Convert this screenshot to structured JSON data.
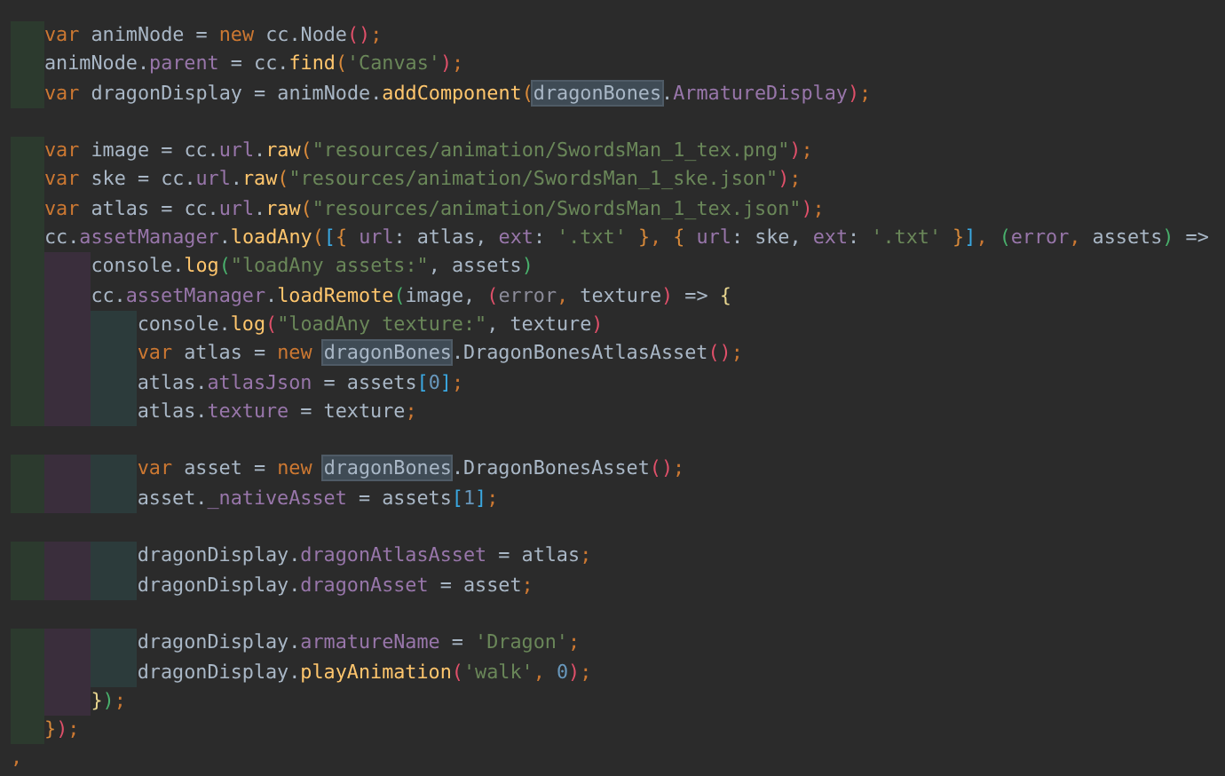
{
  "editor": {
    "lines": [
      {
        "kind": "code",
        "tokens": [
          {
            "kind": "keyword",
            "text": "var "
          },
          {
            "kind": "ident",
            "text": "animNode = "
          },
          {
            "kind": "keyword",
            "text": "new "
          },
          {
            "kind": "ident",
            "text": "cc.Node"
          },
          {
            "kind": "bracket_pink",
            "text": "()"
          },
          {
            "kind": "punct",
            "text": ";"
          }
        ]
      },
      {
        "kind": "code",
        "tokens": [
          {
            "kind": "ident",
            "text": "animNode."
          },
          {
            "kind": "property",
            "text": "parent"
          },
          {
            "kind": "ident",
            "text": " = cc."
          },
          {
            "kind": "function",
            "text": "find"
          },
          {
            "kind": "bracket_orange",
            "text": "("
          },
          {
            "kind": "string",
            "text": "'Canvas'"
          },
          {
            "kind": "bracket_pink",
            "text": ")"
          },
          {
            "kind": "punct",
            "text": ";"
          }
        ]
      },
      {
        "kind": "code",
        "tokens": [
          {
            "kind": "keyword",
            "text": "var "
          },
          {
            "kind": "ident",
            "text": "dragonDisplay = animNode."
          },
          {
            "kind": "function",
            "text": "addComponent"
          },
          {
            "kind": "bracket_orange",
            "text": "("
          },
          {
            "kind": "highlight",
            "text": "dragonBones"
          },
          {
            "kind": "ident",
            "text": "."
          },
          {
            "kind": "property",
            "text": "ArmatureDisplay"
          },
          {
            "kind": "bracket_pink",
            "text": ")"
          },
          {
            "kind": "punct",
            "text": ";"
          }
        ]
      },
      {
        "kind": "blank"
      },
      {
        "kind": "code",
        "tokens": [
          {
            "kind": "keyword",
            "text": "var "
          },
          {
            "kind": "ident",
            "text": "image = cc."
          },
          {
            "kind": "property",
            "text": "url"
          },
          {
            "kind": "ident",
            "text": "."
          },
          {
            "kind": "function",
            "text": "raw"
          },
          {
            "kind": "bracket_orange",
            "text": "("
          },
          {
            "kind": "string",
            "text": "\"resources/animation/SwordsMan_1_tex.png\""
          },
          {
            "kind": "bracket_pink",
            "text": ")"
          },
          {
            "kind": "punct",
            "text": ";"
          }
        ]
      },
      {
        "kind": "code",
        "tokens": [
          {
            "kind": "keyword",
            "text": "var "
          },
          {
            "kind": "ident",
            "text": "ske = cc."
          },
          {
            "kind": "property",
            "text": "url"
          },
          {
            "kind": "ident",
            "text": "."
          },
          {
            "kind": "function",
            "text": "raw"
          },
          {
            "kind": "bracket_orange",
            "text": "("
          },
          {
            "kind": "string",
            "text": "\"resources/animation/SwordsMan_1_ske.json\""
          },
          {
            "kind": "bracket_pink",
            "text": ")"
          },
          {
            "kind": "punct",
            "text": ";"
          }
        ]
      },
      {
        "kind": "code",
        "tokens": [
          {
            "kind": "keyword",
            "text": "var "
          },
          {
            "kind": "ident",
            "text": "atlas = cc."
          },
          {
            "kind": "property",
            "text": "url"
          },
          {
            "kind": "ident",
            "text": "."
          },
          {
            "kind": "function",
            "text": "raw"
          },
          {
            "kind": "bracket_orange",
            "text": "("
          },
          {
            "kind": "string",
            "text": "\"resources/animation/SwordsMan_1_tex.json\""
          },
          {
            "kind": "bracket_pink",
            "text": ")"
          },
          {
            "kind": "punct",
            "text": ";"
          }
        ]
      },
      {
        "kind": "code",
        "tokens": [
          {
            "kind": "ident",
            "text": "cc."
          },
          {
            "kind": "property",
            "text": "assetManager"
          },
          {
            "kind": "ident",
            "text": "."
          },
          {
            "kind": "function",
            "text": "loadAny"
          },
          {
            "kind": "bracket_orange",
            "text": "("
          },
          {
            "kind": "bracket_blue",
            "text": "["
          },
          {
            "kind": "bracket_orange",
            "text": "{ "
          },
          {
            "kind": "property",
            "text": "url"
          },
          {
            "kind": "ident",
            "text": ": atlas, "
          },
          {
            "kind": "property",
            "text": "ext"
          },
          {
            "kind": "ident",
            "text": ": "
          },
          {
            "kind": "string",
            "text": "'.txt'"
          },
          {
            "kind": "bracket_orange",
            "text": " }"
          },
          {
            "kind": "punct",
            "text": ", "
          },
          {
            "kind": "bracket_orange",
            "text": "{ "
          },
          {
            "kind": "property",
            "text": "url"
          },
          {
            "kind": "ident",
            "text": ": ske, "
          },
          {
            "kind": "property",
            "text": "ext"
          },
          {
            "kind": "ident",
            "text": ": "
          },
          {
            "kind": "string",
            "text": "'.txt'"
          },
          {
            "kind": "bracket_orange",
            "text": " }"
          },
          {
            "kind": "bracket_blue",
            "text": "]"
          },
          {
            "kind": "punct",
            "text": ", "
          },
          {
            "kind": "bracket_green",
            "text": "("
          },
          {
            "kind": "property",
            "text": "error"
          },
          {
            "kind": "punct",
            "text": ", "
          },
          {
            "kind": "ident",
            "text": "assets"
          },
          {
            "kind": "bracket_green",
            "text": ")"
          },
          {
            "kind": "ident",
            "text": " =>"
          }
        ],
        "children": [
          {
            "kind": "code",
            "tokens": [
              {
                "kind": "ident",
                "text": "console."
              },
              {
                "kind": "function",
                "text": "log"
              },
              {
                "kind": "bracket_green",
                "text": "("
              },
              {
                "kind": "string",
                "text": "\"loadAny assets:\""
              },
              {
                "kind": "ident",
                "text": ", assets"
              },
              {
                "kind": "bracket_green",
                "text": ")"
              }
            ]
          },
          {
            "kind": "code",
            "tokens": [
              {
                "kind": "ident",
                "text": "cc."
              },
              {
                "kind": "property",
                "text": "assetManager"
              },
              {
                "kind": "ident",
                "text": "."
              },
              {
                "kind": "function",
                "text": "loadRemote"
              },
              {
                "kind": "bracket_green",
                "text": "("
              },
              {
                "kind": "ident",
                "text": "image, "
              },
              {
                "kind": "bracket_pink",
                "text": "("
              },
              {
                "kind": "param",
                "text": "error"
              },
              {
                "kind": "punct",
                "text": ", "
              },
              {
                "kind": "ident",
                "text": "texture"
              },
              {
                "kind": "bracket_pink",
                "text": ")"
              },
              {
                "kind": "ident",
                "text": " => "
              },
              {
                "kind": "bracket_yellow",
                "text": "{"
              }
            ],
            "children": [
              {
                "kind": "code",
                "tokens": [
                  {
                    "kind": "ident",
                    "text": "console."
                  },
                  {
                    "kind": "function",
                    "text": "log"
                  },
                  {
                    "kind": "bracket_pink",
                    "text": "("
                  },
                  {
                    "kind": "string",
                    "text": "\"loadAny texture:\""
                  },
                  {
                    "kind": "ident",
                    "text": ", texture"
                  },
                  {
                    "kind": "bracket_pink",
                    "text": ")"
                  }
                ]
              },
              {
                "kind": "code",
                "tokens": [
                  {
                    "kind": "keyword",
                    "text": "var "
                  },
                  {
                    "kind": "ident",
                    "text": "atlas = "
                  },
                  {
                    "kind": "keyword",
                    "text": "new "
                  },
                  {
                    "kind": "highlight",
                    "text": "dragonBones"
                  },
                  {
                    "kind": "ident",
                    "text": ".DragonBonesAtlasAsset"
                  },
                  {
                    "kind": "bracket_pink",
                    "text": "()"
                  },
                  {
                    "kind": "punct",
                    "text": ";"
                  }
                ]
              },
              {
                "kind": "code",
                "tokens": [
                  {
                    "kind": "ident",
                    "text": "atlas."
                  },
                  {
                    "kind": "property",
                    "text": "atlasJson"
                  },
                  {
                    "kind": "ident",
                    "text": " = assets"
                  },
                  {
                    "kind": "bracket_blue",
                    "text": "["
                  },
                  {
                    "kind": "number",
                    "text": "0"
                  },
                  {
                    "kind": "bracket_blue",
                    "text": "]"
                  },
                  {
                    "kind": "punct",
                    "text": ";"
                  }
                ]
              },
              {
                "kind": "code",
                "tokens": [
                  {
                    "kind": "ident",
                    "text": "atlas."
                  },
                  {
                    "kind": "property",
                    "text": "texture"
                  },
                  {
                    "kind": "ident",
                    "text": " = texture"
                  },
                  {
                    "kind": "punct",
                    "text": ";"
                  }
                ]
              },
              {
                "kind": "blank"
              },
              {
                "kind": "code",
                "tokens": [
                  {
                    "kind": "keyword",
                    "text": "var "
                  },
                  {
                    "kind": "ident",
                    "text": "asset = "
                  },
                  {
                    "kind": "keyword",
                    "text": "new "
                  },
                  {
                    "kind": "highlight",
                    "text": "dragonBones"
                  },
                  {
                    "kind": "ident",
                    "text": ".DragonBonesAsset"
                  },
                  {
                    "kind": "bracket_pink",
                    "text": "()"
                  },
                  {
                    "kind": "punct",
                    "text": ";"
                  }
                ]
              },
              {
                "kind": "code",
                "tokens": [
                  {
                    "kind": "ident",
                    "text": "asset."
                  },
                  {
                    "kind": "property",
                    "text": "_nativeAsset"
                  },
                  {
                    "kind": "ident",
                    "text": " = assets"
                  },
                  {
                    "kind": "bracket_blue",
                    "text": "["
                  },
                  {
                    "kind": "number",
                    "text": "1"
                  },
                  {
                    "kind": "bracket_blue",
                    "text": "]"
                  },
                  {
                    "kind": "punct",
                    "text": ";"
                  }
                ]
              },
              {
                "kind": "blank"
              },
              {
                "kind": "code",
                "tokens": [
                  {
                    "kind": "ident",
                    "text": "dragonDisplay."
                  },
                  {
                    "kind": "property",
                    "text": "dragonAtlasAsset"
                  },
                  {
                    "kind": "ident",
                    "text": " = atlas"
                  },
                  {
                    "kind": "punct",
                    "text": ";"
                  }
                ]
              },
              {
                "kind": "code",
                "tokens": [
                  {
                    "kind": "ident",
                    "text": "dragonDisplay."
                  },
                  {
                    "kind": "property",
                    "text": "dragonAsset"
                  },
                  {
                    "kind": "ident",
                    "text": " = asset"
                  },
                  {
                    "kind": "punct",
                    "text": ";"
                  }
                ]
              },
              {
                "kind": "blank"
              },
              {
                "kind": "code",
                "tokens": [
                  {
                    "kind": "ident",
                    "text": "dragonDisplay."
                  },
                  {
                    "kind": "property",
                    "text": "armatureName"
                  },
                  {
                    "kind": "ident",
                    "text": " = "
                  },
                  {
                    "kind": "string",
                    "text": "'Dragon'"
                  },
                  {
                    "kind": "punct",
                    "text": ";"
                  }
                ]
              },
              {
                "kind": "code",
                "tokens": [
                  {
                    "kind": "ident",
                    "text": "dragonDisplay."
                  },
                  {
                    "kind": "function",
                    "text": "playAnimation"
                  },
                  {
                    "kind": "bracket_pink",
                    "text": "("
                  },
                  {
                    "kind": "string",
                    "text": "'walk'"
                  },
                  {
                    "kind": "punct",
                    "text": ", "
                  },
                  {
                    "kind": "number",
                    "text": "0"
                  },
                  {
                    "kind": "bracket_pink",
                    "text": ")"
                  },
                  {
                    "kind": "punct",
                    "text": ";"
                  }
                ]
              }
            ]
          },
          {
            "kind": "code",
            "tokens": [
              {
                "kind": "bracket_yellow",
                "text": "}"
              },
              {
                "kind": "bracket_green",
                "text": ")"
              },
              {
                "kind": "punct",
                "text": ";"
              }
            ]
          }
        ]
      },
      {
        "kind": "code",
        "tokens": [
          {
            "kind": "bracket_orange",
            "text": "}"
          },
          {
            "kind": "bracket_pink",
            "text": ")"
          },
          {
            "kind": "punct",
            "text": ";"
          }
        ]
      },
      {
        "kind": "stray",
        "tokens": [
          {
            "kind": "punct",
            "text": ","
          }
        ]
      }
    ]
  }
}
